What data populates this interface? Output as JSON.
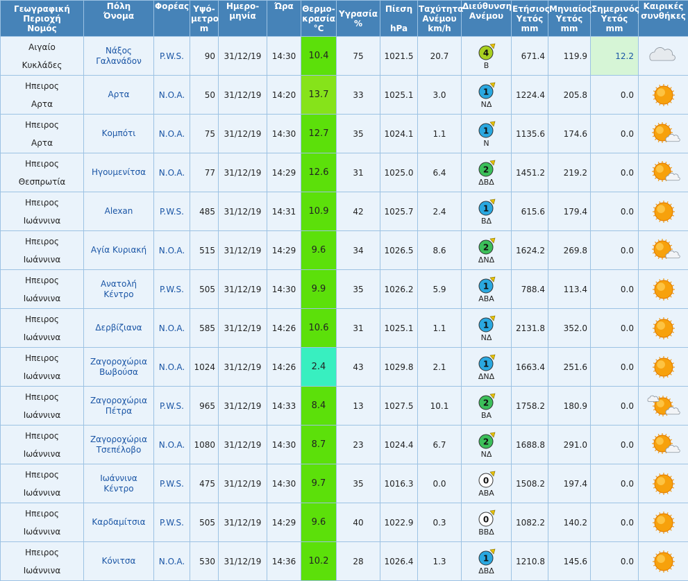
{
  "headers": {
    "region": [
      "Γεωγραφική",
      "Περιοχή",
      "Νομός"
    ],
    "city": [
      "Πόλη",
      "Όνομα"
    ],
    "operator": [
      "Φορέας"
    ],
    "altitude": [
      "Υψό-",
      "μετρο",
      "m"
    ],
    "date": [
      "Ημερο-",
      "μηνία"
    ],
    "time": [
      "Ώρα"
    ],
    "temp": [
      "Θερμο-",
      "κρασία",
      "°C"
    ],
    "humidity": [
      "Υγρασία",
      "",
      "%"
    ],
    "pressure": [
      "Πίεση",
      "",
      "hPa"
    ],
    "wind_speed": [
      "Ταχύτητα",
      "Ανέμου",
      "km/h"
    ],
    "wind_dir": [
      "Διεύθυνση",
      "Ανέμου"
    ],
    "annual_rain": [
      "Ετήσιος",
      "Υετός",
      "mm"
    ],
    "monthly_rain": [
      "Μηνιαίος",
      "Υετός",
      "mm"
    ],
    "today_rain": [
      "Σημερινός",
      "Υετός",
      "mm"
    ],
    "weather": [
      "Καιρικές",
      "συνθήκες"
    ]
  },
  "colors": {
    "header_bg": "#4683b8",
    "row_bg": "#eaf3fb",
    "temp_green": "#5ce00a",
    "temp_lightgreen": "#86e31a",
    "temp_mint": "#38efc0",
    "today_highlight": "#d6f5d6",
    "link_blue": "#1a55a5"
  },
  "rows": [
    {
      "region": "Αιγαίο",
      "prefecture": "Κυκλάδες",
      "city": [
        "Νάξος",
        "Γαλανάδον"
      ],
      "operator": "P.W.S.",
      "altitude": "90",
      "date": "31/12/19",
      "time": "14:30",
      "temp": "10.4",
      "temp_color": "#5ce00a",
      "humidity": "75",
      "pressure": "1021.5",
      "wind_speed": "20.7",
      "beaufort": "4",
      "wind_dir": "Β",
      "wind_icon_color": "#a8d020",
      "annual": "671.4",
      "monthly": "119.9",
      "today": "12.2",
      "today_highlight": true,
      "weather": "cloud-icon"
    },
    {
      "region": "Ηπειρος",
      "prefecture": "Αρτα",
      "city": [
        "Αρτα"
      ],
      "operator": "N.O.A.",
      "altitude": "50",
      "date": "31/12/19",
      "time": "14:20",
      "temp": "13.7",
      "temp_color": "#86e31a",
      "humidity": "33",
      "pressure": "1025.1",
      "wind_speed": "3.0",
      "beaufort": "1",
      "wind_dir": "ΝΔ",
      "wind_icon_color": "#2aa8e0",
      "annual": "1224.4",
      "monthly": "205.8",
      "today": "0.0",
      "today_highlight": false,
      "weather": "sun-icon"
    },
    {
      "region": "Ηπειρος",
      "prefecture": "Αρτα",
      "city": [
        "Κομπότι"
      ],
      "operator": "N.O.A.",
      "altitude": "75",
      "date": "31/12/19",
      "time": "14:30",
      "temp": "12.7",
      "temp_color": "#5ce00a",
      "humidity": "35",
      "pressure": "1024.1",
      "wind_speed": "1.1",
      "beaufort": "1",
      "wind_dir": "Ν",
      "wind_icon_color": "#2aa8e0",
      "annual": "1135.6",
      "monthly": "174.6",
      "today": "0.0",
      "today_highlight": false,
      "weather": "sun-cloud-icon"
    },
    {
      "region": "Ηπειρος",
      "prefecture": "Θεσπρωτία",
      "city": [
        "Ηγουμενίτσα"
      ],
      "operator": "N.O.A.",
      "altitude": "77",
      "date": "31/12/19",
      "time": "14:29",
      "temp": "12.6",
      "temp_color": "#5ce00a",
      "humidity": "31",
      "pressure": "1025.0",
      "wind_speed": "6.4",
      "beaufort": "2",
      "wind_dir": "ΔΒΔ",
      "wind_icon_color": "#3cbf5a",
      "annual": "1451.2",
      "monthly": "219.2",
      "today": "0.0",
      "today_highlight": false,
      "weather": "sun-cloud-icon"
    },
    {
      "region": "Ηπειρος",
      "prefecture": "Ιωάννινα",
      "city": [
        "Alexan"
      ],
      "operator": "P.W.S.",
      "altitude": "485",
      "date": "31/12/19",
      "time": "14:31",
      "temp": "10.9",
      "temp_color": "#5ce00a",
      "humidity": "42",
      "pressure": "1025.7",
      "wind_speed": "2.4",
      "beaufort": "1",
      "wind_dir": "ΒΔ",
      "wind_icon_color": "#2aa8e0",
      "annual": "615.6",
      "monthly": "179.4",
      "today": "0.0",
      "today_highlight": false,
      "weather": "sun-icon"
    },
    {
      "region": "Ηπειρος",
      "prefecture": "Ιωάννινα",
      "city": [
        "Αγία Κυριακή"
      ],
      "operator": "N.O.A.",
      "altitude": "515",
      "date": "31/12/19",
      "time": "14:29",
      "temp": "9.6",
      "temp_color": "#5ce00a",
      "humidity": "34",
      "pressure": "1026.5",
      "wind_speed": "8.6",
      "beaufort": "2",
      "wind_dir": "ΔΝΔ",
      "wind_icon_color": "#3cbf5a",
      "annual": "1624.2",
      "monthly": "269.8",
      "today": "0.0",
      "today_highlight": false,
      "weather": "sun-cloud-icon"
    },
    {
      "region": "Ηπειρος",
      "prefecture": "Ιωάννινα",
      "city": [
        "Ανατολή",
        "Κέντρο"
      ],
      "operator": "P.W.S.",
      "altitude": "505",
      "date": "31/12/19",
      "time": "14:30",
      "temp": "9.9",
      "temp_color": "#5ce00a",
      "humidity": "35",
      "pressure": "1026.2",
      "wind_speed": "5.9",
      "beaufort": "1",
      "wind_dir": "ΑΒΑ",
      "wind_icon_color": "#2aa8e0",
      "annual": "788.4",
      "monthly": "113.4",
      "today": "0.0",
      "today_highlight": false,
      "weather": "sun-icon"
    },
    {
      "region": "Ηπειρος",
      "prefecture": "Ιωάννινα",
      "city": [
        "Δερβίζιανα"
      ],
      "operator": "N.O.A.",
      "altitude": "585",
      "date": "31/12/19",
      "time": "14:26",
      "temp": "10.6",
      "temp_color": "#5ce00a",
      "humidity": "31",
      "pressure": "1025.1",
      "wind_speed": "1.1",
      "beaufort": "1",
      "wind_dir": "ΝΔ",
      "wind_icon_color": "#2aa8e0",
      "annual": "2131.8",
      "monthly": "352.0",
      "today": "0.0",
      "today_highlight": false,
      "weather": "sun-icon"
    },
    {
      "region": "Ηπειρος",
      "prefecture": "Ιωάννινα",
      "city": [
        "Ζαγοροχώρια",
        "Βωβούσα"
      ],
      "operator": "N.O.A.",
      "altitude": "1024",
      "date": "31/12/19",
      "time": "14:26",
      "temp": "2.4",
      "temp_color": "#38efc0",
      "humidity": "43",
      "pressure": "1029.8",
      "wind_speed": "2.1",
      "beaufort": "1",
      "wind_dir": "ΔΝΔ",
      "wind_icon_color": "#2aa8e0",
      "annual": "1663.4",
      "monthly": "251.6",
      "today": "0.0",
      "today_highlight": false,
      "weather": "sun-icon"
    },
    {
      "region": "Ηπειρος",
      "prefecture": "Ιωάννινα",
      "city": [
        "Ζαγοροχώρια",
        "Πέτρα"
      ],
      "operator": "P.W.S.",
      "altitude": "965",
      "date": "31/12/19",
      "time": "14:33",
      "temp": "8.4",
      "temp_color": "#5ce00a",
      "humidity": "13",
      "pressure": "1027.5",
      "wind_speed": "10.1",
      "beaufort": "2",
      "wind_dir": "ΒΑ",
      "wind_icon_color": "#3cbf5a",
      "annual": "1758.2",
      "monthly": "180.9",
      "today": "0.0",
      "today_highlight": false,
      "weather": "cloud-sun-cloud-icon"
    },
    {
      "region": "Ηπειρος",
      "prefecture": "Ιωάννινα",
      "city": [
        "Ζαγοροχώρια",
        "Τσεπέλοβο"
      ],
      "operator": "N.O.A.",
      "altitude": "1080",
      "date": "31/12/19",
      "time": "14:30",
      "temp": "8.7",
      "temp_color": "#5ce00a",
      "humidity": "23",
      "pressure": "1024.4",
      "wind_speed": "6.7",
      "beaufort": "2",
      "wind_dir": "ΝΔ",
      "wind_icon_color": "#3cbf5a",
      "annual": "1688.8",
      "monthly": "291.0",
      "today": "0.0",
      "today_highlight": false,
      "weather": "sun-cloud-icon"
    },
    {
      "region": "Ηπειρος",
      "prefecture": "Ιωάννινα",
      "city": [
        "Ιωάννινα",
        "Κέντρο"
      ],
      "operator": "P.W.S.",
      "altitude": "475",
      "date": "31/12/19",
      "time": "14:30",
      "temp": "9.7",
      "temp_color": "#5ce00a",
      "humidity": "35",
      "pressure": "1016.3",
      "wind_speed": "0.0",
      "beaufort": "0",
      "wind_dir": "ΑΒΑ",
      "wind_icon_color": "#ffffff",
      "annual": "1508.2",
      "monthly": "197.4",
      "today": "0.0",
      "today_highlight": false,
      "weather": "sun-icon"
    },
    {
      "region": "Ηπειρος",
      "prefecture": "Ιωάννινα",
      "city": [
        "Καρδαμίτσια"
      ],
      "operator": "P.W.S.",
      "altitude": "505",
      "date": "31/12/19",
      "time": "14:29",
      "temp": "9.6",
      "temp_color": "#5ce00a",
      "humidity": "40",
      "pressure": "1022.9",
      "wind_speed": "0.3",
      "beaufort": "0",
      "wind_dir": "ΒΒΔ",
      "wind_icon_color": "#ffffff",
      "annual": "1082.2",
      "monthly": "140.2",
      "today": "0.0",
      "today_highlight": false,
      "weather": "sun-icon"
    },
    {
      "region": "Ηπειρος",
      "prefecture": "Ιωάννινα",
      "city": [
        "Κόνιτσα"
      ],
      "operator": "N.O.A.",
      "altitude": "530",
      "date": "31/12/19",
      "time": "14:36",
      "temp": "10.2",
      "temp_color": "#5ce00a",
      "humidity": "28",
      "pressure": "1026.4",
      "wind_speed": "1.3",
      "beaufort": "1",
      "wind_dir": "ΔΒΔ",
      "wind_icon_color": "#2aa8e0",
      "annual": "1210.8",
      "monthly": "145.6",
      "today": "0.0",
      "today_highlight": false,
      "weather": "sun-icon"
    }
  ]
}
